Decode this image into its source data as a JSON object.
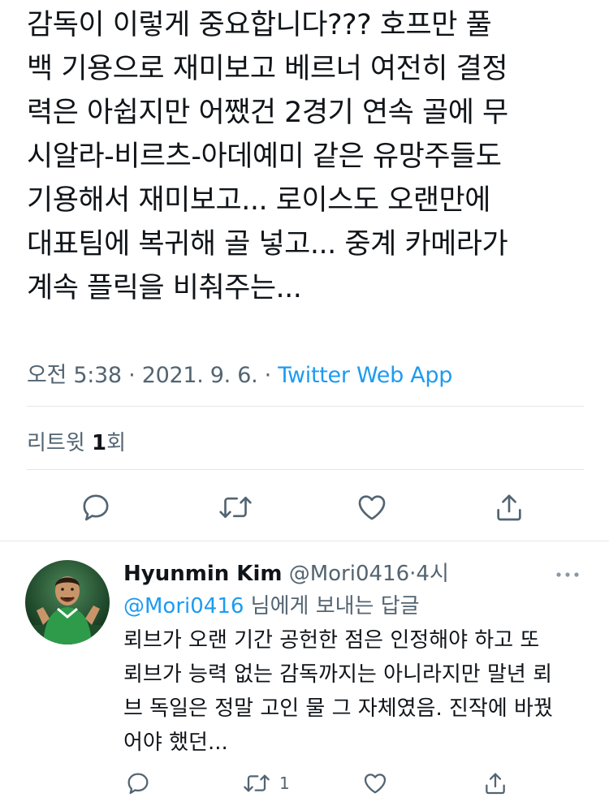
{
  "tweet": {
    "text_lines": [
      "감독이 이렇게 중요합니다??? 호프만 풀",
      "백 기용으로 재미보고 베르너 여전히 결정",
      "력은 아쉽지만 어쨌건 2경기 연속 골에 무",
      "시알라-비르츠-아데예미 같은 유망주들도",
      "기용해서 재미보고... 로이스도 오랜만에",
      "대표팀에 복귀해 골 넣고... 중계 카메라가",
      "계속 플릭을 비춰주는..."
    ],
    "time": "오전 5:38",
    "date": "2021. 9. 6.",
    "separator": "·",
    "source": "Twitter Web App",
    "retweet_label": "리트윗",
    "retweet_count": "1",
    "retweet_unit": "회"
  },
  "actions": {
    "reply_icon": "reply-icon",
    "retweet_icon": "retweet-icon",
    "like_icon": "like-icon",
    "share_icon": "share-icon"
  },
  "reply": {
    "name": "Hyunmin Kim",
    "handle": "@Mori0416",
    "separator": "·",
    "time": "4시",
    "more_icon": "more-icon",
    "replying_mention": "@Mori0416",
    "replying_suffix": " 님에게 보내는 답글",
    "text_lines": [
      "뢰브가 오랜 기간 공헌한 점은 인정해야 하고 또",
      "뢰브가 능력 없는 감독까지는 아니라지만 말년 뢰",
      "브 독일은 정말 고인 물 그 자체였음. 진작에 바꿨",
      "어야 했던..."
    ],
    "retweet_count": "1"
  },
  "colors": {
    "text": "#0f1419",
    "secondary": "#536471",
    "accent": "#1d9bf0",
    "divider": "#e4e8eb"
  }
}
